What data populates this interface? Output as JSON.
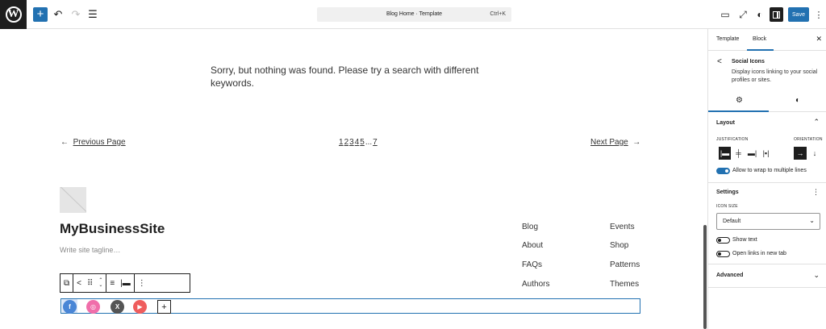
{
  "topbar": {
    "logo_letter": "W",
    "add_label": "+",
    "undo_glyph": "↶",
    "redo_glyph": "↷",
    "list_glyph": "☰",
    "command_title": "Blog Home · Template",
    "command_shortcut": "Ctrl+K",
    "view_glyph": "▭",
    "external_glyph": "⤢",
    "styles_glyph": "◐",
    "save_label": "Save",
    "more_glyph": "⋮"
  },
  "canvas": {
    "not_found_text": "Sorry, but nothing was found. Please try a search with different keywords.",
    "pagination": {
      "prev_arrow": "←",
      "prev_label": "Previous Page",
      "pages": [
        "1",
        "2",
        "3",
        "4",
        "5",
        "...",
        "7"
      ],
      "next_label": "Next Page",
      "next_arrow": "→"
    },
    "site_title": "MyBusinessSite",
    "site_tagline": "Write site tagline…",
    "footer_links": {
      "col1": [
        "Blog",
        "About",
        "FAQs",
        "Authors"
      ],
      "col2": [
        "Events",
        "Shop",
        "Patterns",
        "Themes"
      ]
    },
    "block_toolbar": {
      "transform_glyph": "⧉",
      "share_glyph": "<",
      "drag_glyph": "⠿",
      "up_glyph": "⌃",
      "down_glyph": "⌄",
      "align_glyph": "≡",
      "justify_glyph": "|▬",
      "options_glyph": "⋮"
    },
    "social_icons": {
      "facebook": "f",
      "instagram": "◎",
      "x": "X",
      "youtube": "▶",
      "add": "+"
    }
  },
  "sidebar": {
    "tabs": {
      "template": "Template",
      "block": "Block"
    },
    "close_glyph": "✕",
    "block_info": {
      "icon_glyph": "<",
      "title": "Social Icons",
      "description": "Display icons linking to your social profiles or sites."
    },
    "subtabs": {
      "settings_glyph": "⚙",
      "styles_glyph": "◐"
    },
    "layout": {
      "title": "Layout",
      "toggle_glyph": "⌃",
      "justification_label": "Justification",
      "orientation_label": "Orientation",
      "justify_left": "|▬",
      "justify_center": "╪",
      "justify_right": "▬|",
      "justify_between": "|▪|",
      "orient_horizontal": "→",
      "orient_vertical": "↓",
      "wrap_label": "Allow to wrap to multiple lines"
    },
    "settings": {
      "title": "Settings",
      "menu_glyph": "⋮",
      "icon_size_label": "Icon Size",
      "icon_size_value": "Default",
      "select_glyph": "⌄",
      "show_text_label": "Show text",
      "new_tab_label": "Open links in new tab"
    },
    "advanced": {
      "title": "Advanced",
      "toggle_glyph": "⌄"
    }
  }
}
